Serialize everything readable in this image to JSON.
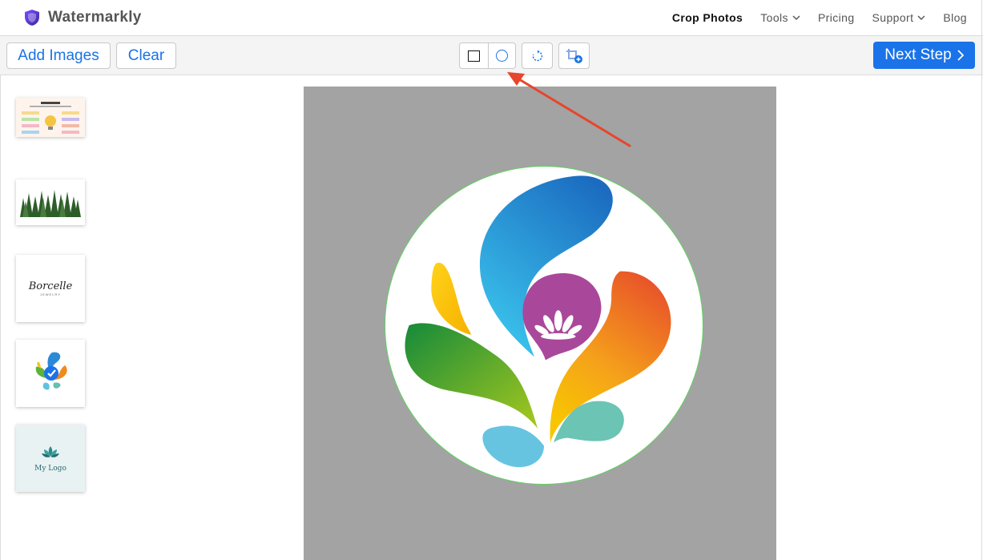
{
  "header": {
    "brand": "Watermarkly",
    "nav": [
      {
        "label": "Crop Photos",
        "active": true,
        "dropdown": false
      },
      {
        "label": "Tools",
        "active": false,
        "dropdown": true
      },
      {
        "label": "Pricing",
        "active": false,
        "dropdown": false
      },
      {
        "label": "Support",
        "active": false,
        "dropdown": true
      },
      {
        "label": "Blog",
        "active": false,
        "dropdown": false
      }
    ]
  },
  "toolbar": {
    "add_images": "Add Images",
    "clear": "Clear",
    "shape_square_icon": "square-crop-icon",
    "shape_circle_icon": "circle-crop-icon",
    "selected_shape": "circle",
    "rotate_icon": "rotate-icon",
    "add_crop_icon": "add-crop-icon",
    "next_step": "Next Step"
  },
  "sidebar": {
    "thumbnails": [
      {
        "name": "infographic"
      },
      {
        "name": "forest"
      },
      {
        "name": "borcelle-logo",
        "text": "Borcelle",
        "sub": "JEWELRY"
      },
      {
        "name": "colorful-logo"
      },
      {
        "name": "my-logo",
        "text": "My Logo"
      }
    ]
  },
  "colors": {
    "accent": "#1a73e8",
    "canvas_bg": "#a3a3a3",
    "crop_outline": "#5fd35f",
    "annotation_arrow": "#e8452c"
  }
}
